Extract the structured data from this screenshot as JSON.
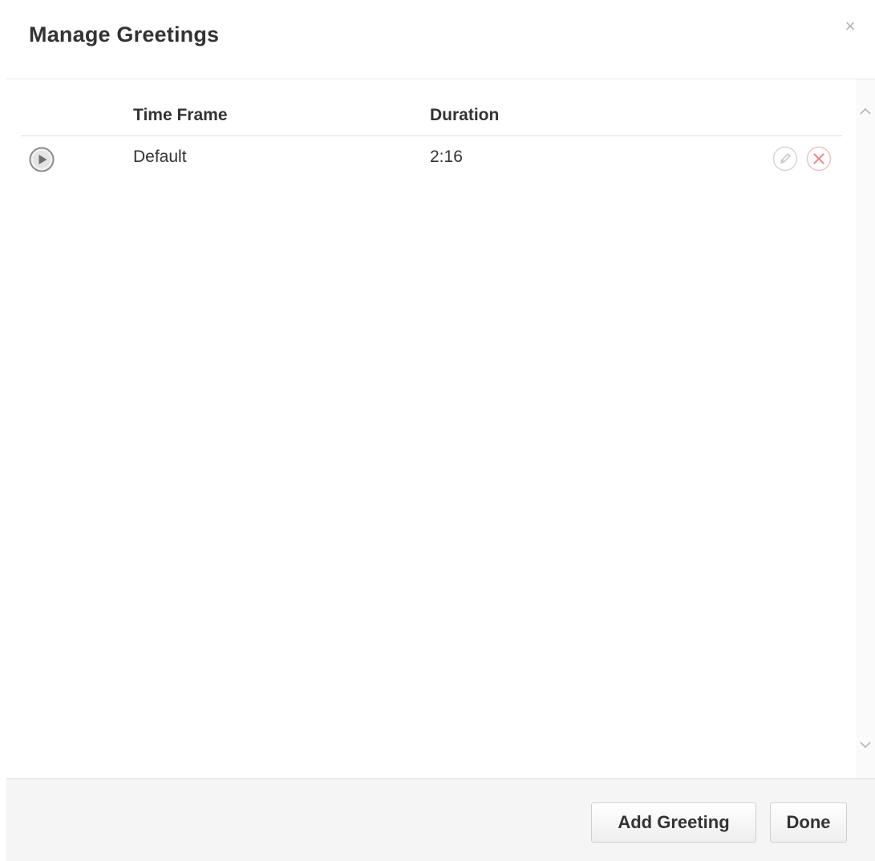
{
  "dialog": {
    "title": "Manage Greetings",
    "close_label": "×"
  },
  "table": {
    "columns": {
      "time_frame": "Time Frame",
      "duration": "Duration"
    },
    "rows": [
      {
        "time_frame": "Default",
        "duration": "2:16",
        "play_icon": "play-icon",
        "edit_icon": "pencil-icon",
        "delete_icon": "delete-x-icon"
      }
    ]
  },
  "scrollbar": {
    "up_icon": "chevron-up-icon",
    "down_icon": "chevron-down-icon"
  },
  "footer": {
    "add_label": "Add Greeting",
    "done_label": "Done"
  },
  "colors": {
    "delete_accent": "#f08a8a",
    "edit_accent": "#c8c8c8",
    "footer_bg": "#f5f5f5"
  }
}
